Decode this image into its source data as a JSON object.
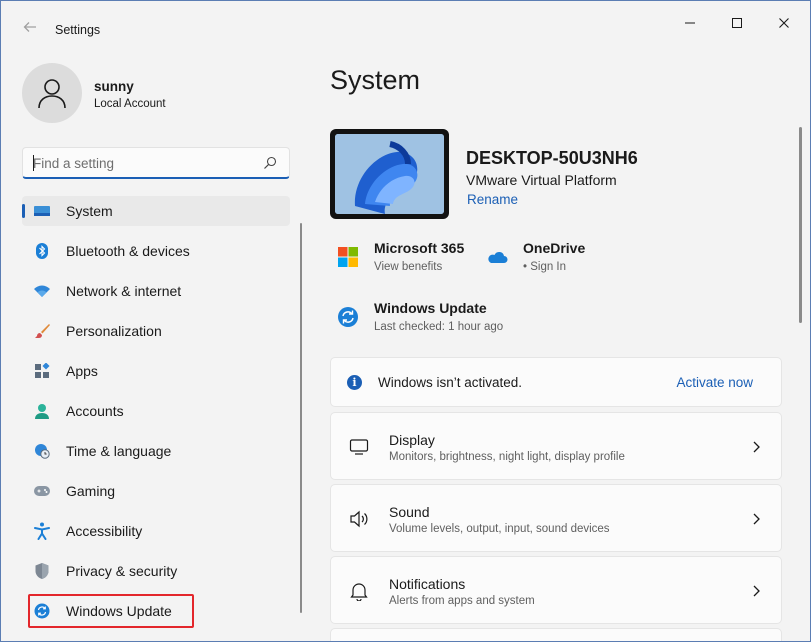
{
  "window": {
    "title": "Settings",
    "back_icon": "back-arrow-icon",
    "controls": [
      "minimize-icon",
      "maximize-icon",
      "close-icon"
    ]
  },
  "profile": {
    "name": "sunny",
    "account_type": "Local Account"
  },
  "search": {
    "placeholder": "Find a setting"
  },
  "sidebar": {
    "items": [
      {
        "label": "System",
        "icon": "system-icon",
        "active": true
      },
      {
        "label": "Bluetooth & devices",
        "icon": "bluetooth-icon"
      },
      {
        "label": "Network & internet",
        "icon": "wifi-icon"
      },
      {
        "label": "Personalization",
        "icon": "brush-icon"
      },
      {
        "label": "Apps",
        "icon": "apps-icon"
      },
      {
        "label": "Accounts",
        "icon": "accounts-icon"
      },
      {
        "label": "Time & language",
        "icon": "globe-clock-icon"
      },
      {
        "label": "Gaming",
        "icon": "gamepad-icon"
      },
      {
        "label": "Accessibility",
        "icon": "accessibility-icon"
      },
      {
        "label": "Privacy & security",
        "icon": "shield-icon"
      },
      {
        "label": "Windows Update",
        "icon": "windows-update-icon",
        "highlighted": true
      }
    ]
  },
  "main": {
    "title": "System",
    "device": {
      "name": "DESKTOP-50U3NH6",
      "model": "VMware Virtual Platform",
      "rename_label": "Rename"
    },
    "quick_links": [
      {
        "title": "Microsoft 365",
        "subtitle": "View benefits",
        "icon": "microsoft-logo-icon"
      },
      {
        "title": "OneDrive",
        "subtitle": "• Sign In",
        "icon": "onedrive-cloud-icon"
      },
      {
        "title": "Windows Update",
        "subtitle": "Last checked: 1 hour ago",
        "icon": "windows-update-icon"
      }
    ],
    "activation": {
      "message": "Windows isn’t activated.",
      "action_label": "Activate now"
    },
    "settings": [
      {
        "title": "Display",
        "subtitle": "Monitors, brightness, night light, display profile",
        "icon": "monitor-icon"
      },
      {
        "title": "Sound",
        "subtitle": "Volume levels, output, input, sound devices",
        "icon": "speaker-icon"
      },
      {
        "title": "Notifications",
        "subtitle": "Alerts from apps and system",
        "icon": "bell-icon"
      }
    ]
  },
  "colors": {
    "accent": "#1b5fb5",
    "highlight_border": "#e3262b",
    "background": "#f3f3f3"
  }
}
